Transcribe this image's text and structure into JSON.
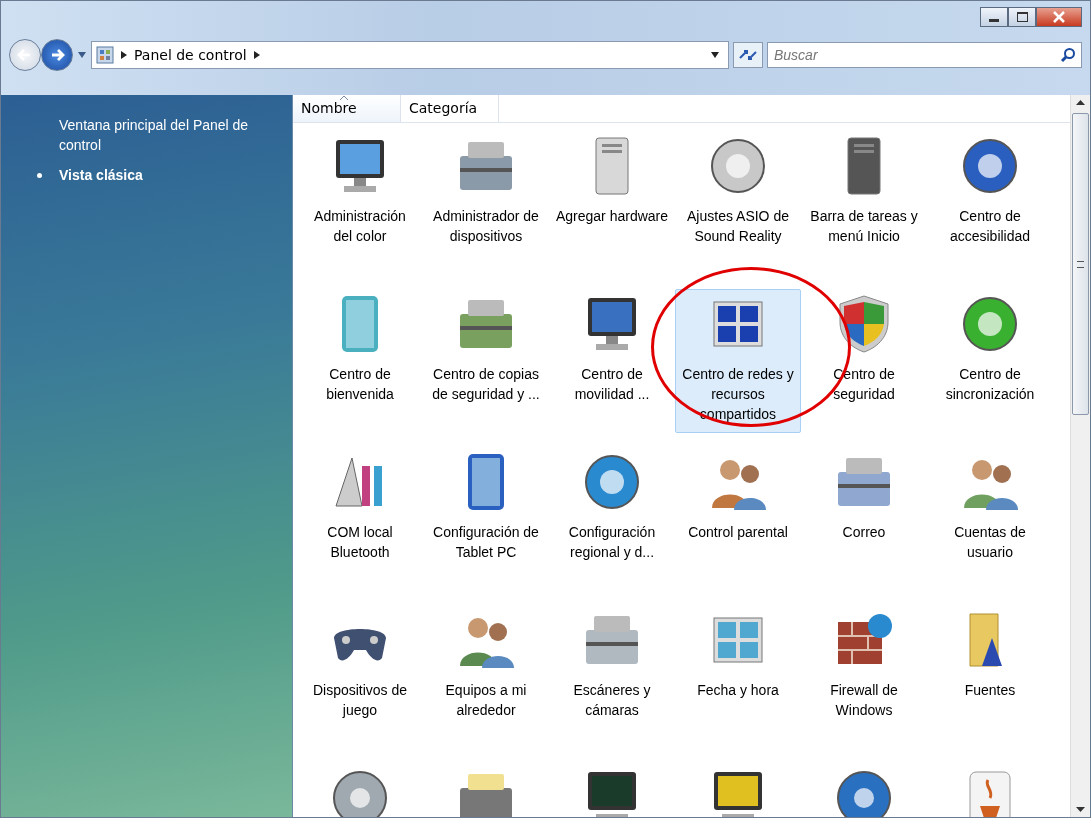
{
  "address_bar": {
    "path": "Panel de control"
  },
  "search": {
    "placeholder": "Buscar"
  },
  "sidebar": {
    "items": [
      {
        "label": "Ventana principal del Panel de control",
        "selected": false
      },
      {
        "label": "Vista clásica",
        "selected": true
      }
    ]
  },
  "columns": [
    {
      "label": "Nombre",
      "sorted": true
    },
    {
      "label": "Categoría",
      "sorted": false
    }
  ],
  "items": [
    {
      "label": "Administración del color",
      "selected": false
    },
    {
      "label": "Administrador de dispositivos",
      "selected": false
    },
    {
      "label": "Agregar hardware",
      "selected": false
    },
    {
      "label": "Ajustes ASIO de Sound Reality",
      "selected": false
    },
    {
      "label": "Barra de tareas y menú Inicio",
      "selected": false
    },
    {
      "label": "Centro de accesibilidad",
      "selected": false
    },
    {
      "label": "Centro de bienvenida",
      "selected": false
    },
    {
      "label": "Centro de copias de seguridad y ...",
      "selected": false
    },
    {
      "label": "Centro de movilidad ...",
      "selected": false
    },
    {
      "label": "Centro de redes y recursos compartidos",
      "selected": true
    },
    {
      "label": "Centro de seguridad",
      "selected": false
    },
    {
      "label": "Centro de sincronización",
      "selected": false
    },
    {
      "label": "COM local Bluetooth",
      "selected": false
    },
    {
      "label": "Configuración de Tablet PC",
      "selected": false
    },
    {
      "label": "Configuración regional y d...",
      "selected": false
    },
    {
      "label": "Control parental",
      "selected": false
    },
    {
      "label": "Correo",
      "selected": false
    },
    {
      "label": "Cuentas de usuario",
      "selected": false
    },
    {
      "label": "Dispositivos de juego",
      "selected": false
    },
    {
      "label": "Equipos a mi alrededor",
      "selected": false
    },
    {
      "label": "Escáneres y cámaras",
      "selected": false
    },
    {
      "label": "Fecha y hora",
      "selected": false
    },
    {
      "label": "Firewall de Windows",
      "selected": false
    },
    {
      "label": "Fuentes",
      "selected": false
    }
  ]
}
